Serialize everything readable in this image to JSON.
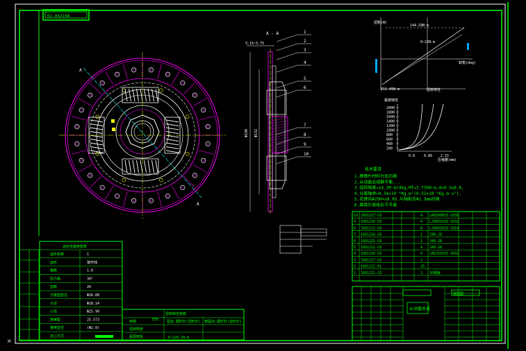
{
  "drawing": {
    "code_box": "02-04210A",
    "section_label": "A - A",
    "section_marks": [
      "A",
      "A"
    ],
    "dim_thickness": "3.15~3.75",
    "dim_outer": "Φ190",
    "dim_inner": "Φ132"
  },
  "balloons": [
    "1",
    "2",
    "3",
    "4",
    "5",
    "6",
    "7",
    "8",
    "9",
    "10"
  ],
  "torsion_chart": {
    "title": "扭转特性",
    "top_label": "144.29N·m",
    "mid_label": "6~22N·m",
    "left_label": "扭矩(N)",
    "right_label": "转角(deg)",
    "bottom_label": "151.49N·m"
  },
  "load_chart": {
    "title": "载荷特性",
    "y_ticks": [
      "2000",
      "1800",
      "1600",
      "1400",
      "1200",
      "1000",
      "800",
      "600",
      "400",
      "200"
    ],
    "x_ticks": [
      "0.8",
      "0.86",
      "2.15"
    ],
    "x_label": "压缩量(mm)"
  },
  "notes": {
    "title": "技术要求",
    "lines": [
      "1.摩擦片材料为无石棉",
      "2.从动盘总成静平衡...",
      "3.扭转刚度=14.2N·m/deg,Mf=3.73kN·m,d=0.3≤0.9,",
      "4.分离轴承=0.34×10⁻⁴Kg.m²(0.52×10⁻⁴Kg.m·s²),",
      "5.花键齿Φ25H=±0.05,与轴配合Φ1.3mm间隙",
      "6.摩擦片铆接后不平度"
    ]
  },
  "parts": [
    {
      "no": "10",
      "code": "1601227-C8",
      "qty": "4",
      "name": "LM16X0015-1039"
    },
    {
      "no": "9",
      "code": "1601216-C8",
      "qty": "4",
      "name": "LJ00X1010-1032"
    },
    {
      "no": "8",
      "code": "1601122-C8",
      "qty": "8",
      "name": "LJ00X1010-1014"
    },
    {
      "no": "7",
      "code": "1601226-C8",
      "qty": "1",
      "name": "J40-28"
    },
    {
      "no": "6",
      "code": "1601225-C8",
      "qty": "1",
      "name": "J40-28"
    },
    {
      "no": "5",
      "code": "1601211-C8",
      "qty": "4",
      "name": "J40-28"
    },
    {
      "no": "4",
      "code": "1601116-C8",
      "qty": "4",
      "name": "LM12X1015-1032"
    },
    {
      "no": "3",
      "code": "1601217-C8",
      "qty": "1",
      "name": ""
    },
    {
      "no": "2",
      "code": "1601222-01",
      "qty": "16",
      "name": ""
    },
    {
      "no": "1",
      "code": "1601221-C8",
      "qty": "2",
      "name": "30钢板"
    }
  ],
  "spline_table": {
    "title": "齿形花键参数表",
    "rows": [
      {
        "label": "齿形系数",
        "value": "1"
      },
      {
        "label": "齿形",
        "value": "渐开线"
      },
      {
        "label": "模数",
        "value": "1.0"
      },
      {
        "label": "压力角",
        "value": "30°"
      },
      {
        "label": "齿数",
        "value": "26"
      },
      {
        "label": "分度圆直径",
        "value": "Φ26.00"
      },
      {
        "label": "大径",
        "value": "Φ28.14"
      },
      {
        "label": "小径",
        "value": "Φ25.90"
      },
      {
        "label": "跨棒距",
        "value": "25.573"
      },
      {
        "label": "量棒直径",
        "value": "(Φ2.0)"
      },
      {
        "label": "定心方式",
        "value": ""
      }
    ]
  },
  "param_table": {
    "header": "扭转特性参数",
    "col1": "参数",
    "col2": "方向",
    "col3": "驱动-顺时针(逆时针)",
    "col4": "被驱动-顺时针(逆时针)",
    "rows": [
      "扭转刚度",
      "极限转矩"
    ],
    "footer": "6~220.1N·m"
  },
  "title_block": {
    "name": "从动盘总成",
    "material": "装配图",
    "drawing_no": "",
    "sheet": ""
  },
  "close_glyph": "×"
}
